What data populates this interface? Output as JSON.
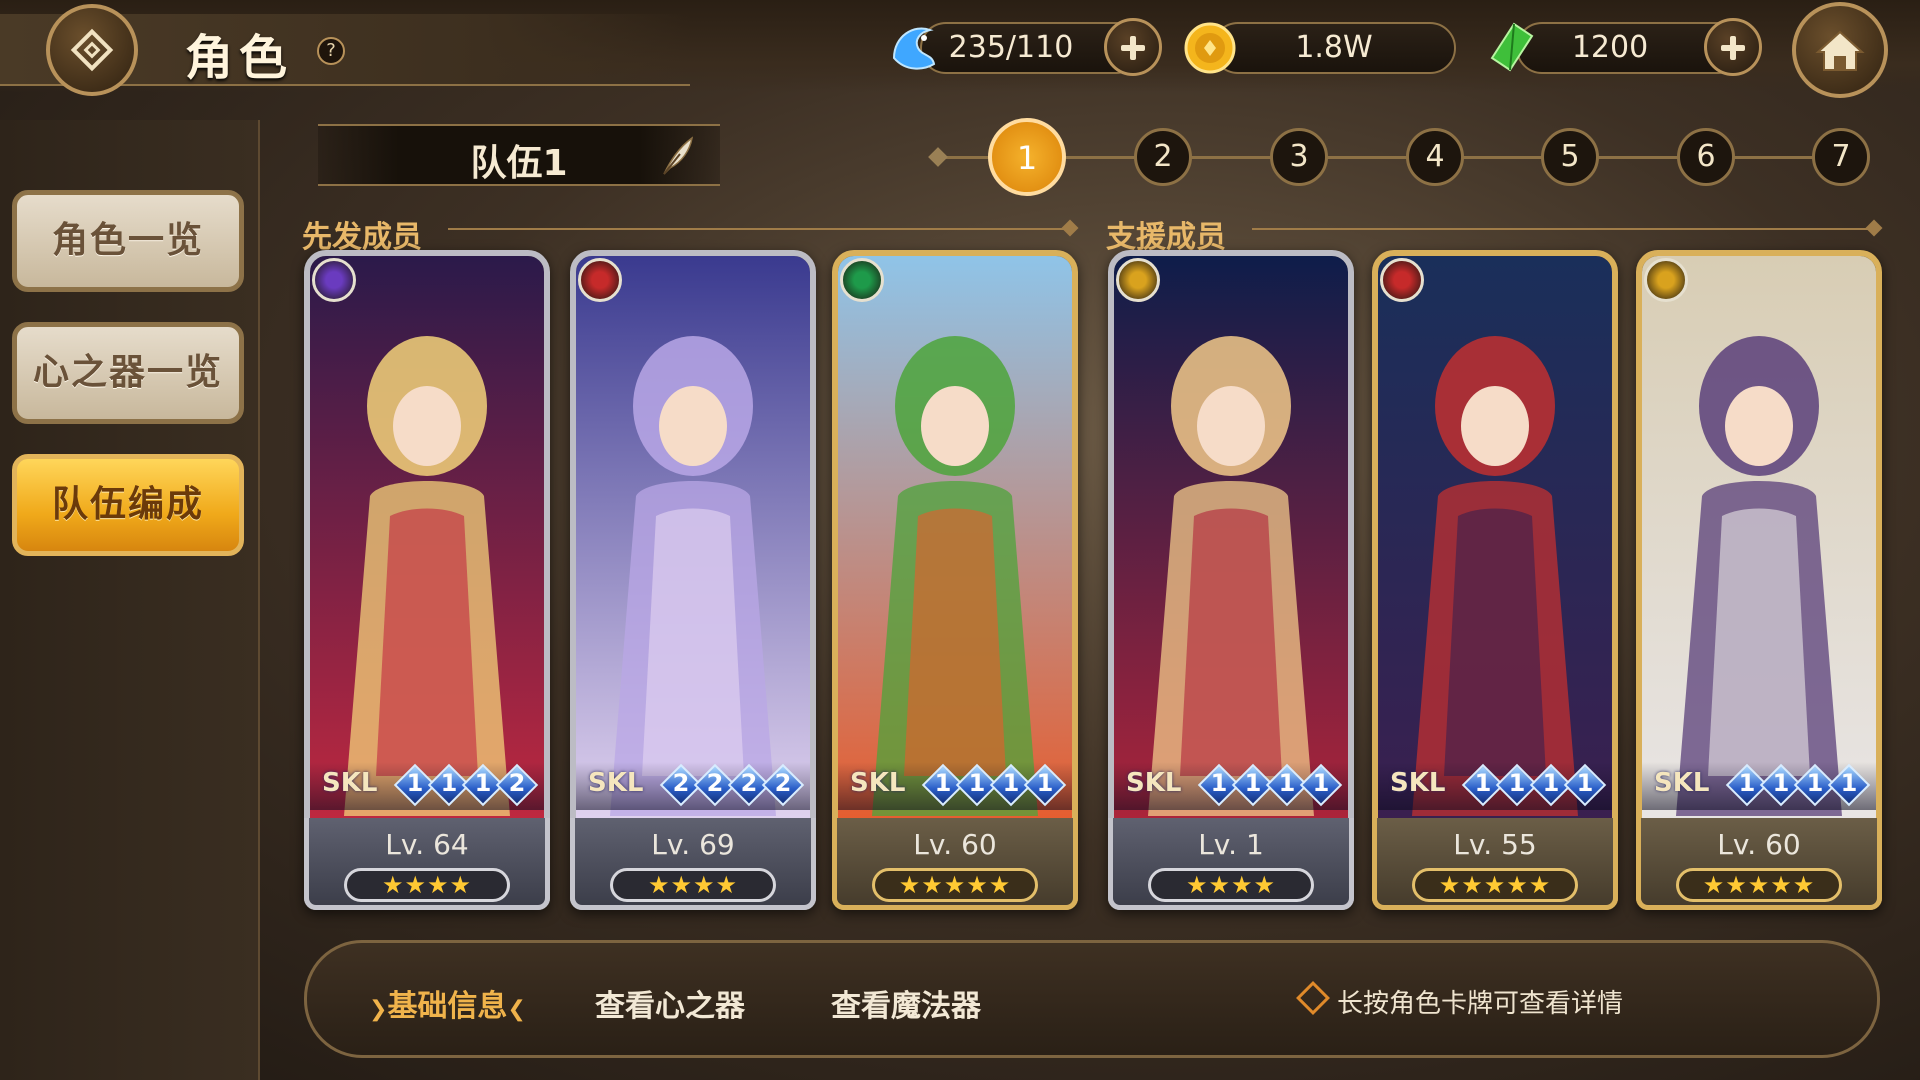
{
  "header": {
    "title": "角色",
    "help_symbol": "?",
    "back_icon": "diamond-back-icon",
    "home_icon": "home-icon"
  },
  "currencies": [
    {
      "name": "stamina",
      "icon": "blue-dolphin-icon",
      "amount": "235/110",
      "has_add": true
    },
    {
      "name": "gold",
      "icon": "gold-coin-icon",
      "amount": "1.8W",
      "has_add": false
    },
    {
      "name": "gem",
      "icon": "green-crystal-icon",
      "amount": "1200",
      "has_add": true
    }
  ],
  "sidebar": {
    "items": [
      {
        "label": "角色一览",
        "active": false
      },
      {
        "label": "心之器一览",
        "active": false
      },
      {
        "label": "队伍编成",
        "active": true
      }
    ]
  },
  "team": {
    "name": "队伍1",
    "edit_icon": "quill-pen-icon",
    "pages": [
      "1",
      "2",
      "3",
      "4",
      "5",
      "6",
      "7"
    ],
    "active_page": "1"
  },
  "sections": {
    "starting": "先发成员",
    "support": "支援成员"
  },
  "cards": [
    {
      "element": "dark-moon",
      "element_color": "#6a3bbf",
      "skl_label": "SKL",
      "skills": [
        "1",
        "1",
        "1",
        "2"
      ],
      "level": "Lv. 64",
      "stars": "★★★★",
      "rarity": "silver"
    },
    {
      "element": "fire",
      "element_color": "#c62a2a",
      "skl_label": "SKL",
      "skills": [
        "2",
        "2",
        "2",
        "2"
      ],
      "level": "Lv. 69",
      "stars": "★★★★",
      "rarity": "silver"
    },
    {
      "element": "wind",
      "element_color": "#1e9a4a",
      "skl_label": "SKL",
      "skills": [
        "1",
        "1",
        "1",
        "1"
      ],
      "level": "Lv. 60",
      "stars": "★★★★★",
      "rarity": "gold"
    },
    {
      "element": "light",
      "element_color": "#d9a21e",
      "skl_label": "SKL",
      "skills": [
        "1",
        "1",
        "1",
        "1"
      ],
      "level": "Lv. 1",
      "stars": "★★★★",
      "rarity": "silver"
    },
    {
      "element": "fire",
      "element_color": "#c62a2a",
      "skl_label": "SKL",
      "skills": [
        "1",
        "1",
        "1",
        "1"
      ],
      "level": "Lv. 55",
      "stars": "★★★★★",
      "rarity": "gold"
    },
    {
      "element": "light",
      "element_color": "#d9a21e",
      "skl_label": "SKL",
      "skills": [
        "1",
        "1",
        "1",
        "1"
      ],
      "level": "Lv. 60",
      "stars": "★★★★★",
      "rarity": "gold"
    }
  ],
  "bottom": {
    "tabs": [
      {
        "label": "基础信息",
        "active": true
      },
      {
        "label": "查看心之器",
        "active": false
      },
      {
        "label": "查看魔法器",
        "active": false
      }
    ],
    "hint": "长按角色卡牌可查看详情"
  }
}
